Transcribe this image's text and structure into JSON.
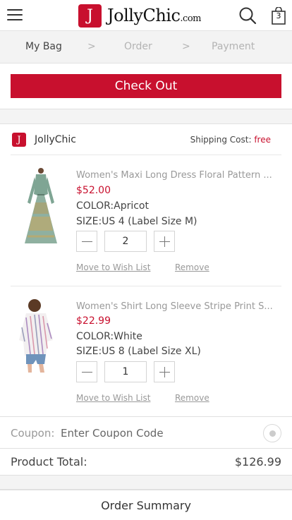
{
  "header": {
    "logo_letter": "J",
    "logo_name": "JollyChic",
    "logo_suffix": ".com",
    "cart_count": "3"
  },
  "steps": [
    "My Bag",
    ">",
    "Order",
    ">",
    "Payment"
  ],
  "checkout_label": "Check Out",
  "store": {
    "logo_letter": "J",
    "name": "JollyChic",
    "shipping_label": "Shipping Cost:",
    "shipping_value": "free"
  },
  "items": [
    {
      "title": "Women's Maxi Long Dress Floral Pattern ...",
      "price": "$52.00",
      "color": "COLOR:Apricot",
      "size": "SIZE:US 4 (Label Size M)",
      "quantity": "2",
      "wish_label": "Move to Wish List",
      "remove_label": "Remove"
    },
    {
      "title": "Women's Shirt Long Sleeve Stripe Print S...",
      "price": "$22.99",
      "color": "COLOR:White",
      "size": "SIZE:US 8 (Label Size XL)",
      "quantity": "1",
      "wish_label": "Move to Wish List",
      "remove_label": "Remove"
    }
  ],
  "coupon": {
    "label": "Coupon:",
    "placeholder": "Enter Coupon Code"
  },
  "total": {
    "label": "Product Total:",
    "value": "$126.99"
  },
  "summary_label": "Order Summary",
  "colors": {
    "brand": "#c8102e"
  }
}
